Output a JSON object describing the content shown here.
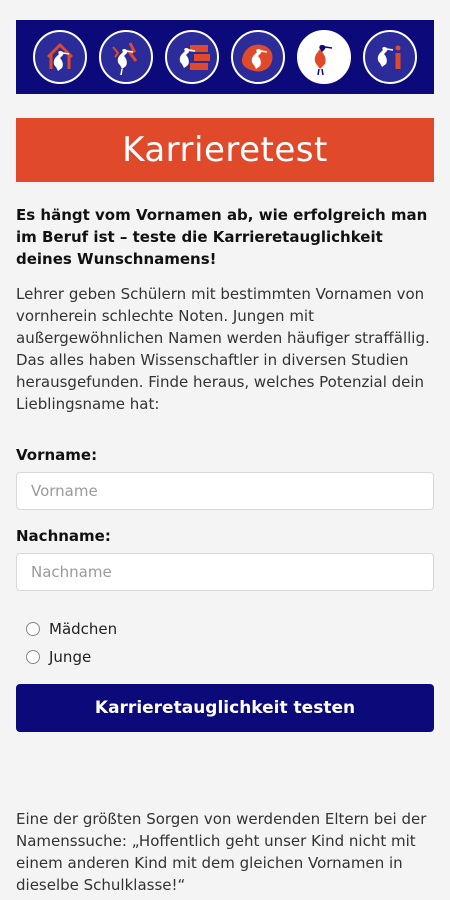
{
  "icons": [
    {
      "name": "stork-house-icon",
      "active": false
    },
    {
      "name": "stork-broken-icon",
      "active": false
    },
    {
      "name": "stork-wall-icon",
      "active": false
    },
    {
      "name": "stork-map-icon",
      "active": false
    },
    {
      "name": "stork-red-icon",
      "active": true
    },
    {
      "name": "stork-info-icon",
      "active": false
    }
  ],
  "colors": {
    "navy": "#0c0a7a",
    "accent": "#e04a2a",
    "background": "#f4f4f4"
  },
  "title": "Karrieretest",
  "lead": "Es hängt vom Vornamen ab, wie erfolgreich man im Beruf ist – teste die Karrieretauglichkeit deines Wunschnamens!",
  "intro": "Lehrer geben Schülern mit bestimmten Vornamen von vornherein schlechte Noten. Jungen mit außergewöhnlichen Namen werden häufiger straffällig. Das alles haben Wissenschaftler in diversen Studien herausgefunden. Finde heraus, welches Potenzial dein Lieblingsname hat:",
  "form": {
    "firstname_label": "Vorname:",
    "firstname_placeholder": "Vorname",
    "lastname_label": "Nachname:",
    "lastname_placeholder": "Nachname",
    "gender_options": [
      "Mädchen",
      "Junge"
    ],
    "submit_label": "Karrieretauglichkeit testen"
  },
  "footer": "Eine der größten Sorgen von werdenden Eltern bei der Namenssuche: „Hoffentlich geht unser Kind nicht mit einem anderen Kind mit dem gleichen Vornamen in dieselbe Schulklasse!“"
}
